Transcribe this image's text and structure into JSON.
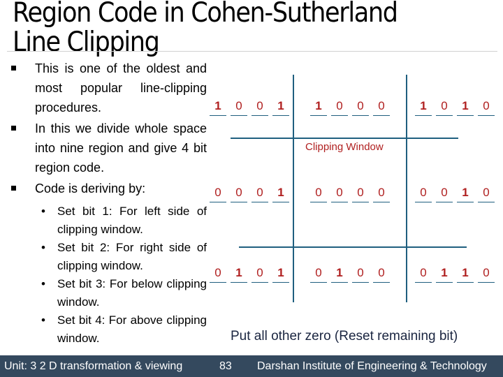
{
  "slide": {
    "title": "Region Code in Cohen-Sutherland Line Clipping",
    "bullets": [
      "This is one of the oldest and most popular line-clipping procedures.",
      "In this we divide whole space into nine region and give 4 bit region code.",
      "Code is deriving by:"
    ],
    "sub_bullets": [
      "Set bit 1: For left side of clipping window.",
      "Set bit 2: For right side of clipping window.",
      "Set bit 3: For below clipping window.",
      "Set bit 4: For above clipping window."
    ]
  },
  "diagram": {
    "window_label": "Clipping Window",
    "region_codes": [
      [
        "1",
        "0",
        "0",
        "1"
      ],
      [
        "1",
        "0",
        "0",
        "0"
      ],
      [
        "1",
        "0",
        "1",
        "0"
      ],
      [
        "0",
        "0",
        "0",
        "1"
      ],
      [
        "0",
        "0",
        "0",
        "0"
      ],
      [
        "0",
        "0",
        "1",
        "0"
      ],
      [
        "0",
        "1",
        "0",
        "1"
      ],
      [
        "0",
        "1",
        "0",
        "0"
      ],
      [
        "0",
        "1",
        "1",
        "0"
      ]
    ],
    "bit_color": "#b02020",
    "line_color": "#1f5f7f",
    "note": "Put all other zero (Reset remaining bit)"
  },
  "footer": {
    "unit": "Unit: 3 2 D transformation & viewing",
    "page": "83",
    "institute": "Darshan Institute of Engineering & Technology",
    "background": "#34495e"
  }
}
